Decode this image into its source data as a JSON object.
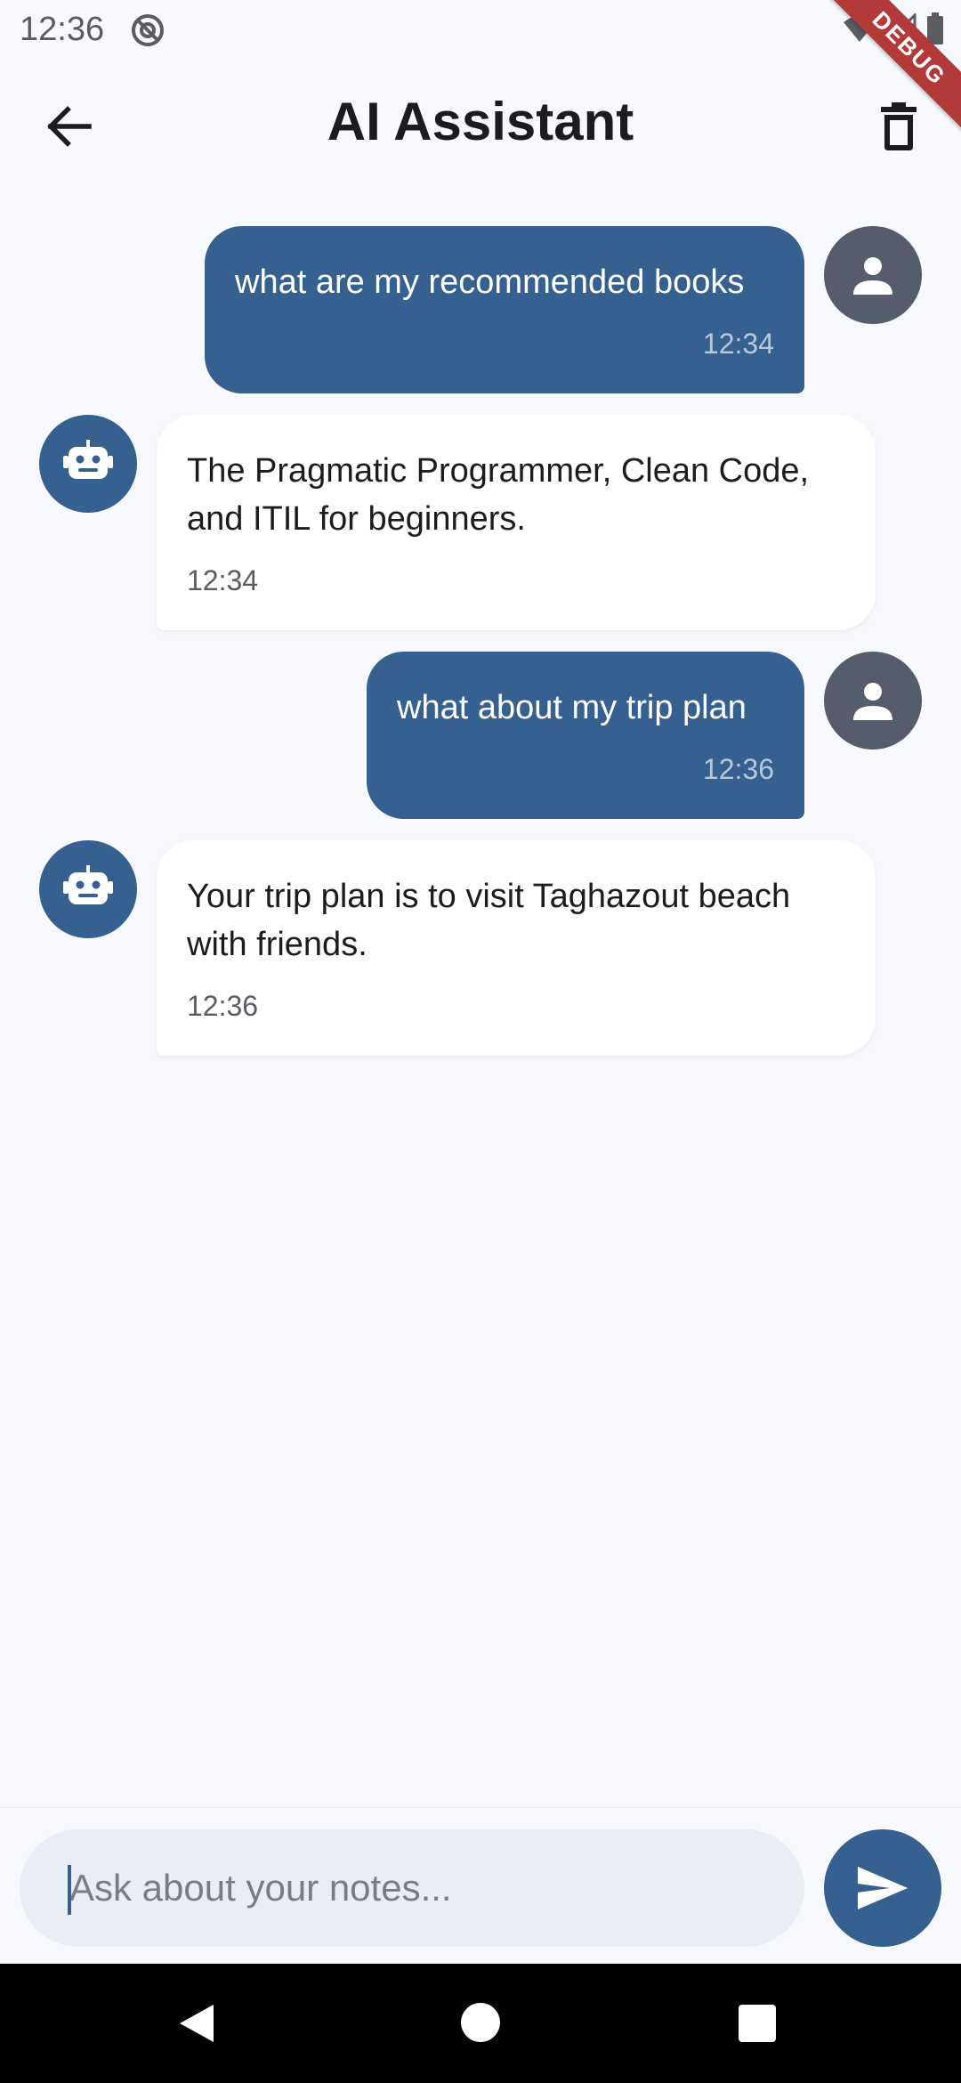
{
  "status_bar": {
    "time": "12:36"
  },
  "debug_banner": "DEBUG",
  "app_bar": {
    "title": "AI Assistant"
  },
  "messages": [
    {
      "role": "user",
      "text": "what are my recommended books",
      "time": "12:34"
    },
    {
      "role": "bot",
      "text": "The Pragmatic Programmer, Clean Code, and ITIL for beginners.",
      "time": "12:34"
    },
    {
      "role": "user",
      "text": "what about my trip plan",
      "time": "12:36"
    },
    {
      "role": "bot",
      "text": "Your trip plan is to visit Taghazout beach with friends.",
      "time": "12:36"
    }
  ],
  "input": {
    "placeholder": "Ask about your notes...",
    "value": ""
  },
  "icons": {
    "back": "arrow-back-icon",
    "delete": "trash-icon",
    "user_avatar": "person-icon",
    "bot_avatar": "robot-icon",
    "send": "send-icon"
  },
  "colors": {
    "accent": "#35608f",
    "background": "#f8f9fe",
    "user_avatar": "#555d6c",
    "bot_bubble": "#ffffff"
  }
}
